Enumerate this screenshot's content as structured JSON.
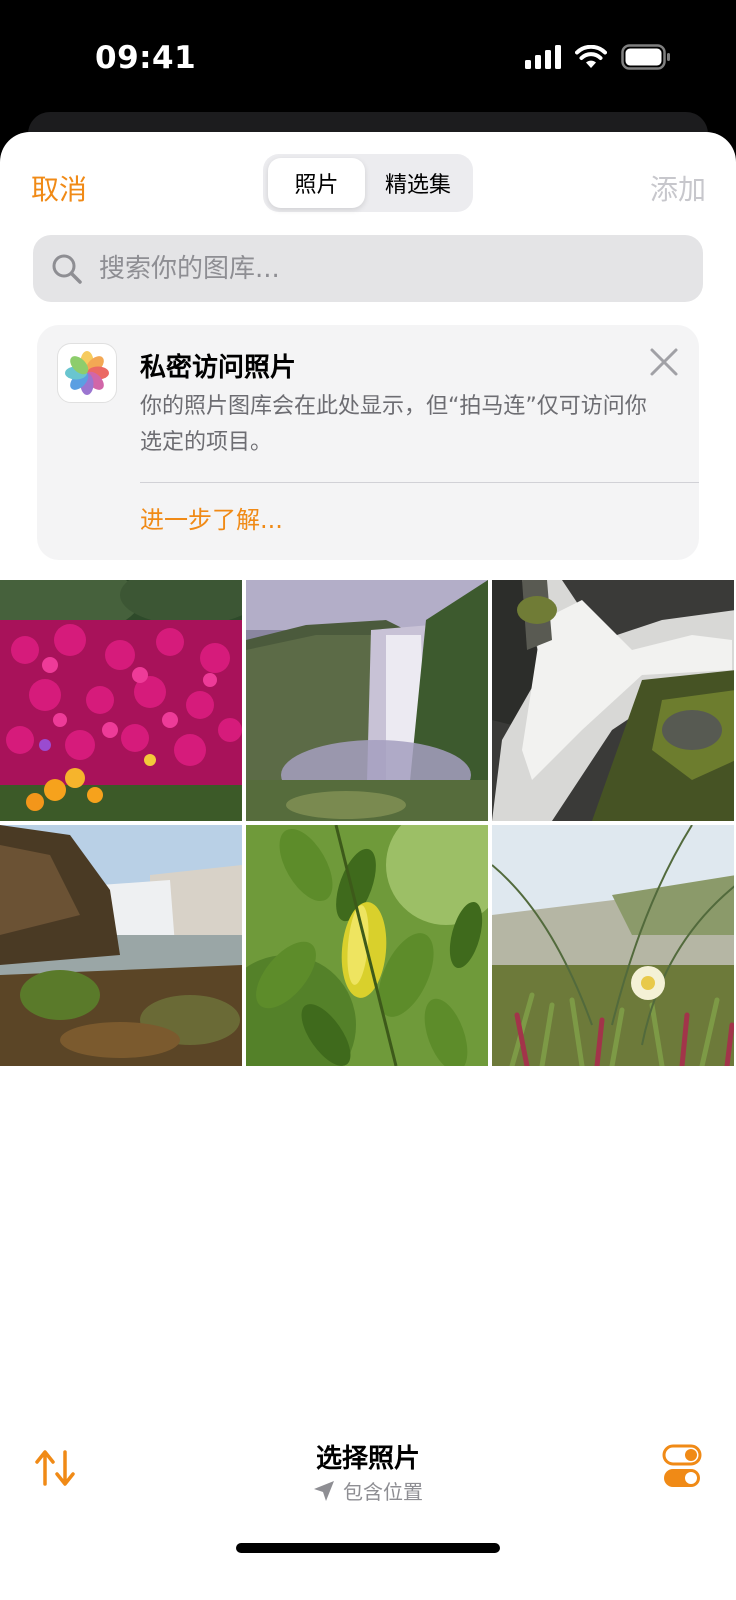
{
  "status_bar": {
    "time": "09:41",
    "icons": [
      "signal-icon",
      "wifi-icon",
      "battery-icon"
    ]
  },
  "nav": {
    "cancel_label": "取消",
    "add_label": "添加",
    "tabs": [
      {
        "label": "照片",
        "selected": true
      },
      {
        "label": "精选集",
        "selected": false
      }
    ]
  },
  "search": {
    "placeholder": "搜索你的图库..."
  },
  "privacy_card": {
    "title": "私密访问照片",
    "body": "你的照片图库会在此处显示，但“拍马连”仅可访问你选定的项目。",
    "link": "进一步了解...",
    "icon": "photos-app-icon"
  },
  "photos": [
    {
      "name": "magenta-flowers-photo"
    },
    {
      "name": "waterfall-cliff-photo"
    },
    {
      "name": "rapids-rocks-photo"
    },
    {
      "name": "waterfall-river-photo"
    },
    {
      "name": "green-leaves-photo"
    },
    {
      "name": "dune-flower-photo"
    }
  ],
  "toolbar": {
    "title": "选择照片",
    "subtitle": "包含位置",
    "sort_icon": "sort-arrows-icon",
    "options_icon": "toggles-icon"
  },
  "colors": {
    "accent": "#f08a16",
    "disabled": "#c7c7cc",
    "secondary_text": "#8e8e93"
  }
}
